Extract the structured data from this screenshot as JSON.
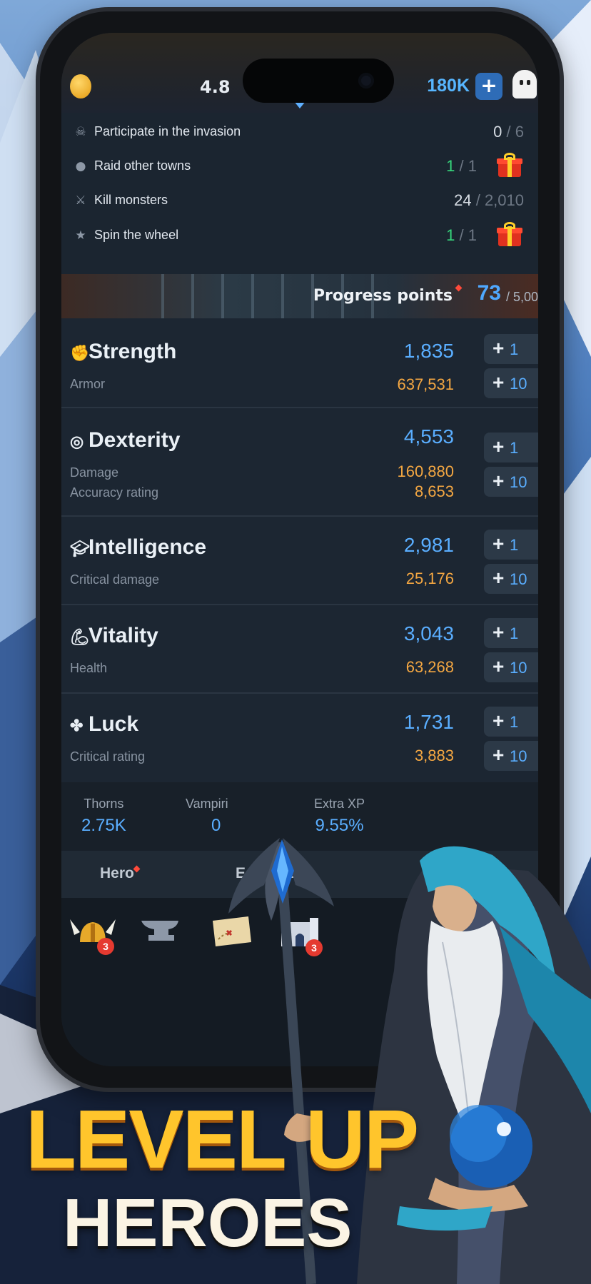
{
  "topbar": {
    "resource_value": "4.8",
    "gems": "180K",
    "add_label": "+"
  },
  "quests": [
    {
      "label": "Participate in the invasion",
      "current": "0",
      "total": "6",
      "icon": "skull-icon",
      "done": false
    },
    {
      "label": "Raid other towns",
      "current": "1",
      "total": "1",
      "icon": "fire-icon",
      "done": true
    },
    {
      "label": "Kill monsters",
      "current": "24",
      "total": "2,010",
      "icon": "sword-icon",
      "done": false
    },
    {
      "label": "Spin the wheel",
      "current": "1",
      "total": "1",
      "icon": "star-icon",
      "done": true
    }
  ],
  "progress": {
    "label": "Progress points",
    "value": "73",
    "max": "/ 5,00"
  },
  "stats": [
    {
      "name": "Strength",
      "value": "1,835",
      "icon": "fist-icon",
      "subs": [
        {
          "label": "Armor",
          "value": "637,531"
        }
      ]
    },
    {
      "name": "Dexterity",
      "value": "4,553",
      "icon": "target-icon",
      "subs": [
        {
          "label": "Damage",
          "value": "160,880"
        },
        {
          "label": "Accuracy rating",
          "value": "8,653"
        }
      ]
    },
    {
      "name": "Intelligence",
      "value": "2,981",
      "icon": "graduation-cap-icon",
      "subs": [
        {
          "label": "Critical damage",
          "value": "25,176"
        }
      ]
    },
    {
      "name": "Vitality",
      "value": "3,043",
      "icon": "arm-icon",
      "subs": [
        {
          "label": "Health",
          "value": "63,268"
        }
      ]
    },
    {
      "name": "Luck",
      "value": "1,731",
      "icon": "clover-icon",
      "subs": [
        {
          "label": "Critical rating",
          "value": "3,883"
        }
      ]
    }
  ],
  "increment": {
    "plus": "+",
    "one": "1",
    "ten": "10"
  },
  "extras": [
    {
      "label": "Thorns",
      "value": "2.75K"
    },
    {
      "label": "Vampiri",
      "value": "0"
    },
    {
      "label": "Extra XP",
      "value": "9.55%"
    }
  ],
  "tabs": {
    "hero": "Hero",
    "equipment": "Ec ment"
  },
  "nav": [
    {
      "icon": "viking-helmet-icon",
      "badge": "3"
    },
    {
      "icon": "anvil-icon",
      "badge": ""
    },
    {
      "icon": "treasure-map-icon",
      "badge": ""
    },
    {
      "icon": "castle-icon",
      "badge": "3"
    }
  ],
  "promo": {
    "line1": "LEVEL UP",
    "line2": "HEROES"
  },
  "colors": {
    "accent_blue": "#5aaeff",
    "orange": "#f4a742",
    "green": "#36d67c",
    "promo_gold": "#ffc52c"
  }
}
